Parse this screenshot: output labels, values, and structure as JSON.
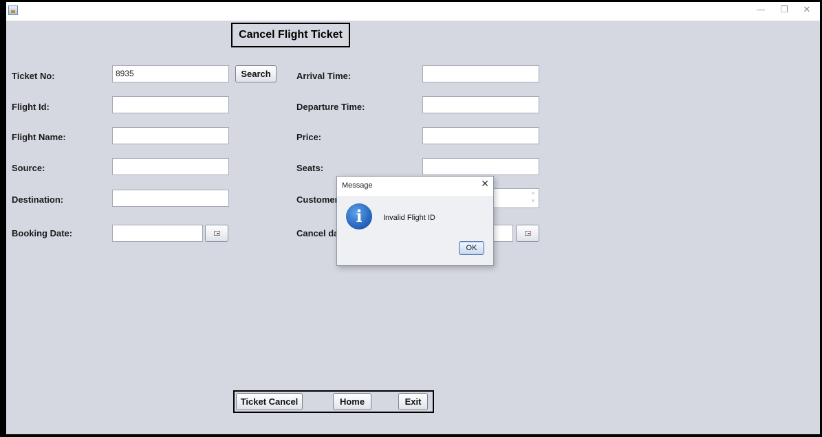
{
  "window": {
    "icon": "java-app-icon",
    "controls": {
      "minimize": "—",
      "restore": "❐",
      "close": "✕"
    }
  },
  "form": {
    "title": "Cancel Flight Ticket",
    "left_fields": [
      {
        "label": "Ticket No:",
        "value": "8935"
      },
      {
        "label": "Flight Id:",
        "value": ""
      },
      {
        "label": "Flight Name:",
        "value": ""
      },
      {
        "label": "Source:",
        "value": ""
      },
      {
        "label": "Destination:",
        "value": ""
      },
      {
        "label": "Booking Date:",
        "value": ""
      }
    ],
    "right_fields": [
      {
        "label": "Arrival Time:",
        "value": ""
      },
      {
        "label": "Departure Time:",
        "value": ""
      },
      {
        "label": "Price:",
        "value": ""
      },
      {
        "label": "Seats:",
        "value": ""
      },
      {
        "label": "Customer",
        "value": ""
      },
      {
        "label": "Cancel dat",
        "value": ""
      }
    ],
    "search_label": "Search",
    "buttons": {
      "ticket_cancel": "Ticket Cancel",
      "home": "Home",
      "exit": "Exit"
    }
  },
  "dialog": {
    "title": "Message",
    "close": "✕",
    "icon": "information-icon",
    "icon_glyph": "i",
    "message": "Invalid Flight ID",
    "ok_label": "OK"
  }
}
